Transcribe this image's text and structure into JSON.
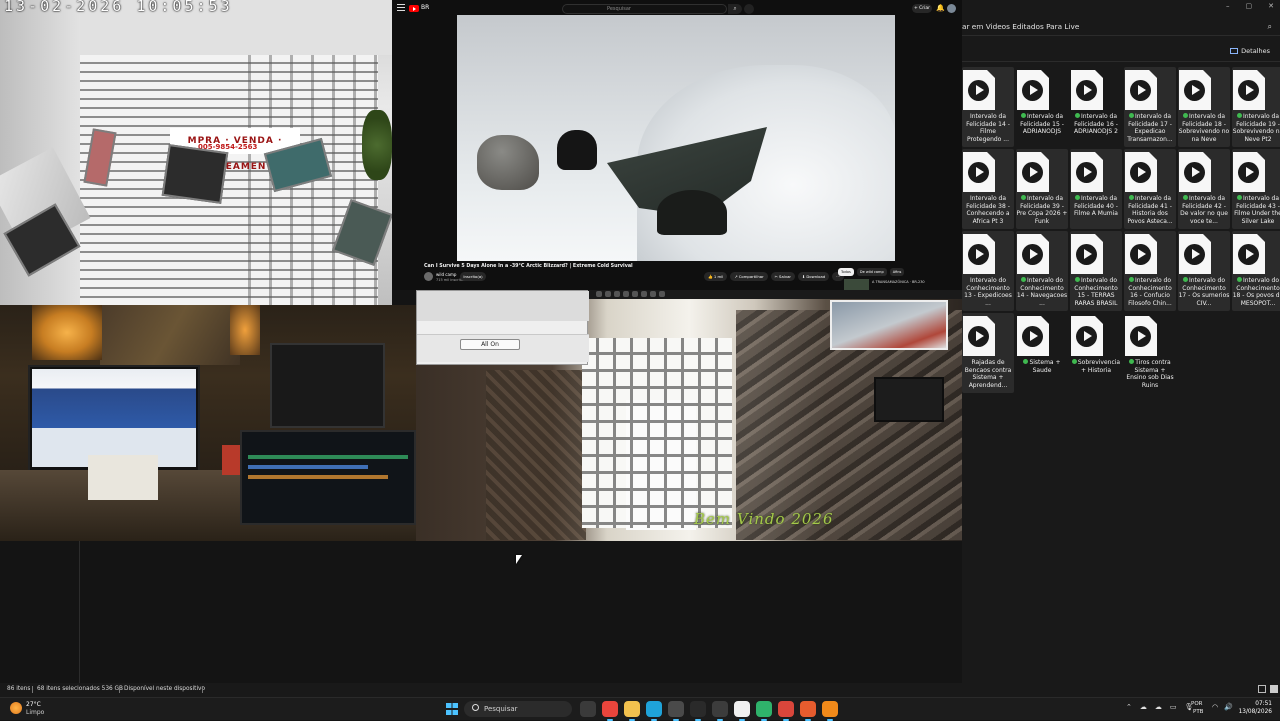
{
  "camera_top_left": {
    "timestamp": "13-02-2026  10:05:53",
    "sign_text": "MPRA · VENDA · LOTEAMEN",
    "sign_phone": "005-9854-2563"
  },
  "youtube": {
    "logo_text": "BR",
    "search_placeholder": "Pesquisar",
    "search_icon": "search-icon",
    "create_label": "+ Criar",
    "bell_icon": "bell-icon",
    "video_title": "Can I Survive 5 Days Alone In a -39°C Arctic Blizzard? | Extreme Cold Survival",
    "channel_name": "wild camp",
    "channel_subs": "715 mil inscritos",
    "subscribe_label": "Inscrito(a)",
    "actions": [
      "👍 1 mil",
      "↗ Compartilhar",
      "✂ Salvar",
      "⬇ Download",
      "···"
    ],
    "chips": [
      {
        "label": "Todos",
        "active": true
      },
      {
        "label": "De wild camp",
        "active": false
      },
      {
        "label": "Afins",
        "active": false
      }
    ],
    "suggestion_text": "A TRANSAMAZÔNICA · BR-230"
  },
  "explorer": {
    "address_path": "ar em Videos Editados Para Live",
    "search_icon": "search-icon",
    "details_label": "Detalhes",
    "files": [
      {
        "name": "Intervalo da Felicidade 14 - Filme Protegendo ...",
        "synced": false,
        "selected": true
      },
      {
        "name": "Intervalo da Felicidade 15 - ADRIANODJS",
        "synced": true,
        "selected": false
      },
      {
        "name": "Intervalo da Felicidade 16 - ADRIANODJS 2",
        "synced": true,
        "selected": false
      },
      {
        "name": "Intervalo da Felicidade 17 - Expedicao Transamazon...",
        "synced": true,
        "selected": true
      },
      {
        "name": "Intervalo da Felicidade 18 - Sobrevivendo no na Neve",
        "synced": true,
        "selected": true
      },
      {
        "name": "Intervalo da Felicidade 19 - Sobrevivendo na Neve Pt2",
        "synced": true,
        "selected": true
      },
      {
        "name": "Intervalo da Felicidade 38 - Conhecendo a Africa Pt 3",
        "synced": false,
        "selected": true
      },
      {
        "name": "Intervalo da Felicidade 39 - Pre Copa 2026 + Funk",
        "synced": true,
        "selected": true
      },
      {
        "name": "Intervalo da Felicidade 40 - Filme A Mumia",
        "synced": true,
        "selected": true
      },
      {
        "name": "Intervalo da Felicidade 41 - Historia dos Povos Asteca...",
        "synced": true,
        "selected": true
      },
      {
        "name": "Intervalo da Felicidade 42 - De valor no que voce te...",
        "synced": true,
        "selected": true
      },
      {
        "name": "Intervalo da Felicidade 43 - Filme Under the Silver Lake",
        "synced": true,
        "selected": true
      },
      {
        "name": "Intervalo do Conhecimento 13 - Expedicoes ...",
        "synced": false,
        "selected": true
      },
      {
        "name": "Intervalo do Conhecimento 14 - Navegacoes ...",
        "synced": true,
        "selected": true
      },
      {
        "name": "Intervalo do Conhecimento 15 - TERRAS RARAS BRASIL",
        "synced": true,
        "selected": true
      },
      {
        "name": "Intervalo do Conhecimento 16 - Confucio Filosofo Chin...",
        "synced": true,
        "selected": true
      },
      {
        "name": "Intervalo do Conhecimento 17 - Os sumerios CIV...",
        "synced": true,
        "selected": true
      },
      {
        "name": "Intervalo do Conhecimento 18 - Os povos da MESOPOT...",
        "synced": true,
        "selected": true
      },
      {
        "name": "Rajadas de Bencaos contra Sistema + Aprendend...",
        "synced": false,
        "selected": true
      },
      {
        "name": "Sistema + Saude",
        "synced": true,
        "selected": false
      },
      {
        "name": "Sobrevivencia + Historia",
        "synced": true,
        "selected": false
      },
      {
        "name": "Tiros contra Sistema + Ensino sob Dias Ruins",
        "synced": true,
        "selected": false
      }
    ]
  },
  "camera_bottom": {
    "dialog_button": "All On",
    "watermark": "Bem Vindo 2026"
  },
  "status_bar": {
    "items_count": "86 itens",
    "selected": "68 itens selecionados  536 GB",
    "availability": "Disponível neste dispositivo"
  },
  "taskbar": {
    "weather_temp": "27°C",
    "weather_cond": "Limpo",
    "search_label": "Pesquisar",
    "apps": [
      {
        "icon": "task-view-icon",
        "color": "#3a3a3a"
      },
      {
        "icon": "chrome-icon",
        "color": "#e8453c"
      },
      {
        "icon": "file-explorer-icon",
        "color": "#f2c14e"
      },
      {
        "icon": "edge-icon",
        "color": "#1fa3d9"
      },
      {
        "icon": "calculator-icon",
        "color": "#4a4a4a"
      },
      {
        "icon": "capcut-icon",
        "color": "#2a2a2a"
      },
      {
        "icon": "obs-icon",
        "color": "#3c3c3c"
      },
      {
        "icon": "media-player-icon",
        "color": "#f0f0f0"
      },
      {
        "icon": "green-app-icon",
        "color": "#2fb36b"
      },
      {
        "icon": "chrome-profile-icon",
        "color": "#d9463b"
      },
      {
        "icon": "chrome-profile2-icon",
        "color": "#e65c2e"
      },
      {
        "icon": "vlc-icon",
        "color": "#f08a1a"
      }
    ],
    "tray_icons": [
      "chevron-up-icon",
      "cloud-icon",
      "onedrive-icon",
      "battery-icon",
      "mic-icon"
    ],
    "lang_line1": "POR",
    "lang_line2": "PTB",
    "sys_icons": [
      "wifi-icon",
      "volume-icon"
    ],
    "time": "07:51",
    "date": "13/08/2026"
  }
}
